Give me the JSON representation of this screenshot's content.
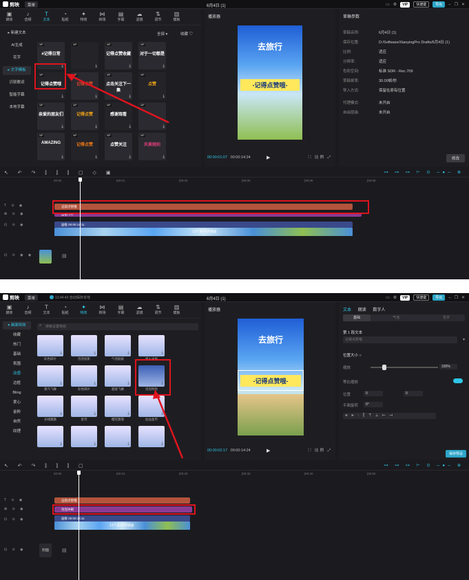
{
  "app": {
    "name": "剪映",
    "layout_menu": "菜单",
    "window_title": "6月4日 (1)",
    "vip": "VIP",
    "shortcut": "快捷键",
    "export": "导出",
    "autosave": "13:44:43 自动保存本地"
  },
  "toolbar": [
    "媒体",
    "音频",
    "文本",
    "贴纸",
    "特效",
    "转场",
    "字幕",
    "滤镜",
    "调节",
    "模板"
  ],
  "screen1": {
    "categories": [
      "▸ 新建文本",
      "AI生成",
      "花字",
      "▸ 文字模板",
      "识别歌词",
      "智能字幕",
      "本地字幕"
    ],
    "filter_all": "全部",
    "filter_fav": "收藏",
    "templates": [
      {
        "title": "#记得日常"
      },
      {
        "title": ""
      },
      {
        "title": "记得点赞收藏"
      },
      {
        "title": "对于一切都是"
      },
      {
        "title": "记得点赞哦"
      },
      {
        "title": "记得点赞"
      },
      {
        "title": "点击关注下一集"
      },
      {
        "title": "点赞"
      },
      {
        "title": "亲爱的朋友们"
      },
      {
        "title": "记得点赞"
      },
      {
        "title": "感谢观看"
      },
      {
        "title": ""
      },
      {
        "title": "AMAZING"
      },
      {
        "title": "记得点赞"
      },
      {
        "title": "点赞关注"
      },
      {
        "title": "风景随拍"
      }
    ],
    "player_title": "播放器",
    "video_heading": "去旅行",
    "video_banner": "-记得点赞哦-",
    "time_current": "00:00:01:07",
    "time_total": "00:00:14:24",
    "ratio_button": "比例",
    "draft_title": "草稿参数",
    "draft_rows": [
      {
        "k": "草稿名称:",
        "v": "6月4日 (1)"
      },
      {
        "k": "保存位置:",
        "v": "D:/Software/XianyingPro Drafts/6月4日 (1)"
      },
      {
        "k": "比例:",
        "v": "适应"
      },
      {
        "k": "分辨率:",
        "v": "适应"
      },
      {
        "k": "色彩空间:",
        "v": "标准 SDR - Rec.709"
      },
      {
        "k": "草稿帧率:",
        "v": "30.00帧/秒"
      },
      {
        "k": "导入方式:",
        "v": "保留在原有位置"
      },
      {
        "k": "代理模式:",
        "v": "未开启"
      },
      {
        "k": "自由层级:",
        "v": "未开启"
      }
    ],
    "modify_button": "修改",
    "ruler_ticks": [
      "00:00",
      "|00:01",
      "|00:03",
      "|00:05",
      "|00:06",
      "|00:08"
    ],
    "text_clip": "记得点赞哦",
    "effect_clip": "自由卡片",
    "main_clip": "画板  00:00:14:11",
    "strip_label": "13个素材拼接画",
    "cover_label": "封面"
  },
  "screen2": {
    "effect_categories": [
      "▾ 画面特效",
      "收藏",
      "热门",
      "基础",
      "氛围",
      "动感",
      "边框",
      "Bling",
      "爱心",
      "金粉",
      "自然",
      "纹理"
    ],
    "search_placeholder": "搜索设置特效",
    "effects": [
      "彩色碎片",
      "泡泡投影",
      "气泡贴纸",
      "星火光斑",
      "蒸汽飞舞",
      "彩色碎片",
      "超级飞舞",
      "泡泡吹吹",
      "光线飘飘",
      "星河",
      "樱花飘落",
      "仙仙金币",
      "",
      "",
      "",
      ""
    ],
    "player_title": "播放器",
    "video_heading": "去旅行",
    "video_banner": "-记得点赞哦-",
    "time_current": "00:00:02:17",
    "time_total": "00:00:14:24",
    "ratio_button": "比例",
    "tabs": [
      "文本",
      "朗读",
      "数字人"
    ],
    "seg": [
      "基础",
      "气泡",
      "花字"
    ],
    "section": "第 1 段文本",
    "text_placeholder": "记得点赞哦",
    "pos_size": "位置大小 ○",
    "scale_label": "缩放",
    "scale_value": "100%",
    "scale_level": 0.2,
    "uniform_label": "等比缩放",
    "position_label": "位置",
    "pos_x": "0",
    "pos_y": "0",
    "rotate_label": "平面旋转",
    "rotate_value": "0°",
    "save_preset": "保存预设",
    "ruler_ticks": [
      "00:00",
      "|00:10",
      "|00:20",
      "|00:30",
      "|00:40",
      "|00:50"
    ],
    "text_clip": "记得点赞哦",
    "effect_clip": "泡泡冲刷",
    "main_clip": "画板  00:00:14:11",
    "strip_label": "13个素材拼接画",
    "cover_label": "封面"
  }
}
